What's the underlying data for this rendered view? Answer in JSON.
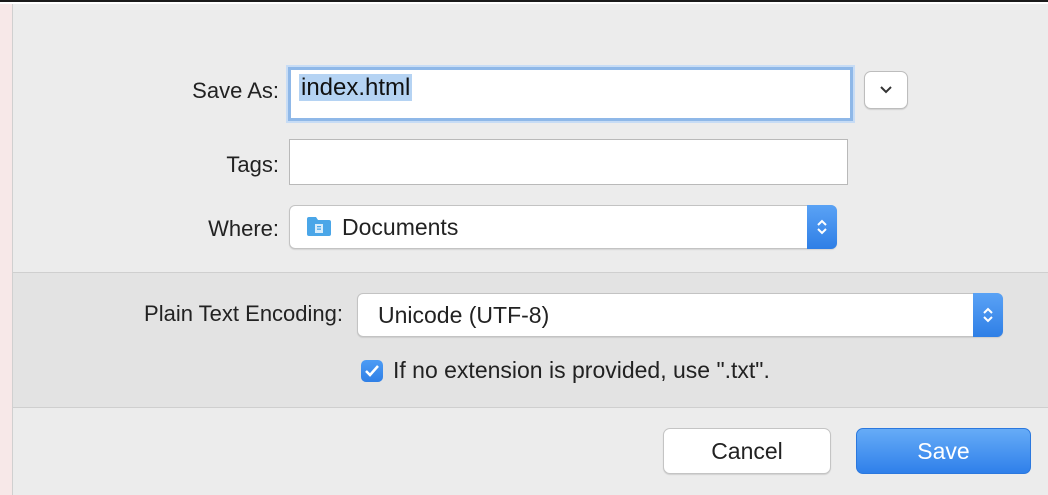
{
  "dialog": {
    "save_as_label": "Save As:",
    "save_as_value": "index.html",
    "tags_label": "Tags:",
    "tags_value": "",
    "where_label": "Where:",
    "where_value": "Documents",
    "where_icon": "folder-icon",
    "encoding_label": "Plain Text Encoding:",
    "encoding_value": "Unicode (UTF-8)",
    "extension_checkbox_checked": true,
    "extension_checkbox_label": "If no extension is provided, use \".txt\".",
    "cancel_label": "Cancel",
    "save_label": "Save"
  },
  "colors": {
    "accent": "#2f80ea",
    "dialog_background": "#ececec",
    "focus_ring": "#8fb8e8"
  }
}
